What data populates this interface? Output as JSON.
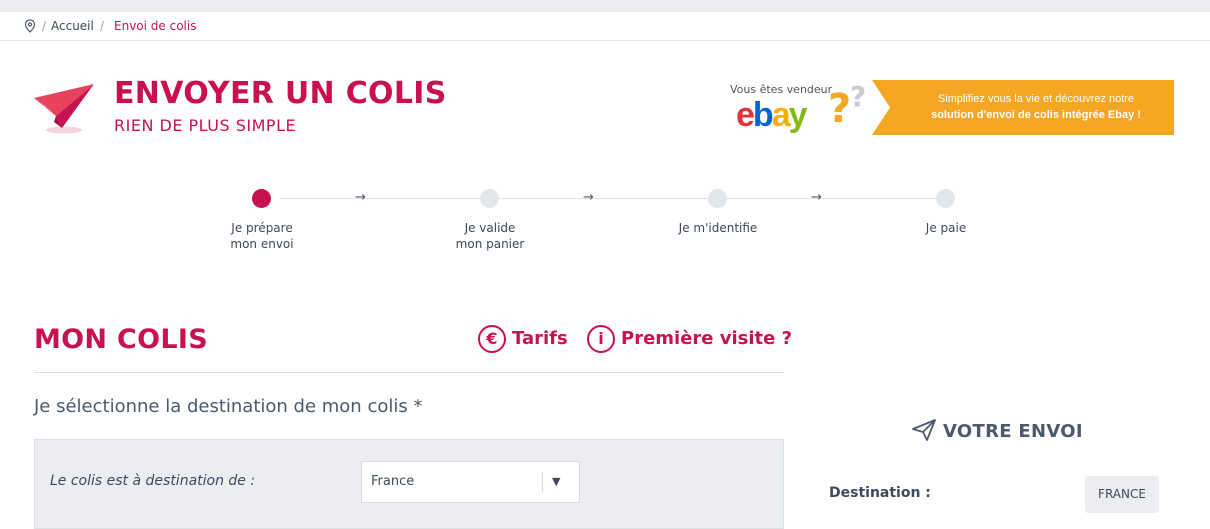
{
  "breadcrumb": {
    "icon": "map-pin-icon",
    "separator": "/",
    "home": "Accueil",
    "current": "Envoi de colis"
  },
  "hero": {
    "icon": "paper-plane-icon",
    "title": "ENVOYER UN COLIS",
    "subtitle": "RIEN DE PLUS SIMPLE"
  },
  "ebay_promo": {
    "pre_text": "Vous êtes vendeur",
    "logo_letters": [
      "e",
      "b",
      "a",
      "y"
    ],
    "logo_colors": [
      "#e53238",
      "#0064d2",
      "#f5af02",
      "#86b817"
    ],
    "question_marks": "??",
    "banner_line1": "Simplifiez vous la vie et découvrez notre",
    "banner_line2": "solution d'envoi de colis intégrée Ebay !",
    "banner_color": "#f5a623"
  },
  "stepper": {
    "arrow": "→",
    "steps": [
      {
        "line1": "Je prépare",
        "line2": "mon envoi",
        "active": true
      },
      {
        "line1": "Je valide",
        "line2": "mon panier",
        "active": false
      },
      {
        "line1": "Je m'identifie",
        "line2": "",
        "active": false
      },
      {
        "line1": "Je paie",
        "line2": "",
        "active": false
      }
    ]
  },
  "section": {
    "title": "MON COLIS",
    "tarifs_icon": "euro-circle-icon",
    "tarifs_symbol": "€",
    "tarifs_label": "Tarifs",
    "visite_icon": "info-circle-icon",
    "visite_symbol": "i",
    "visite_label": "Première visite ?"
  },
  "destination": {
    "heading": "Je sélectionne la destination de mon colis *",
    "field_label": "Le colis est à destination de :",
    "selected_value": "France",
    "caret": "▼"
  },
  "summary": {
    "icon": "paper-plane-outline-icon",
    "title": "VOTRE ENVOI",
    "destination_label": "Destination :",
    "destination_value": "FRANCE"
  },
  "colors": {
    "accent": "#c8124f",
    "text": "#3d4a5c",
    "panel": "#ebedf0"
  }
}
